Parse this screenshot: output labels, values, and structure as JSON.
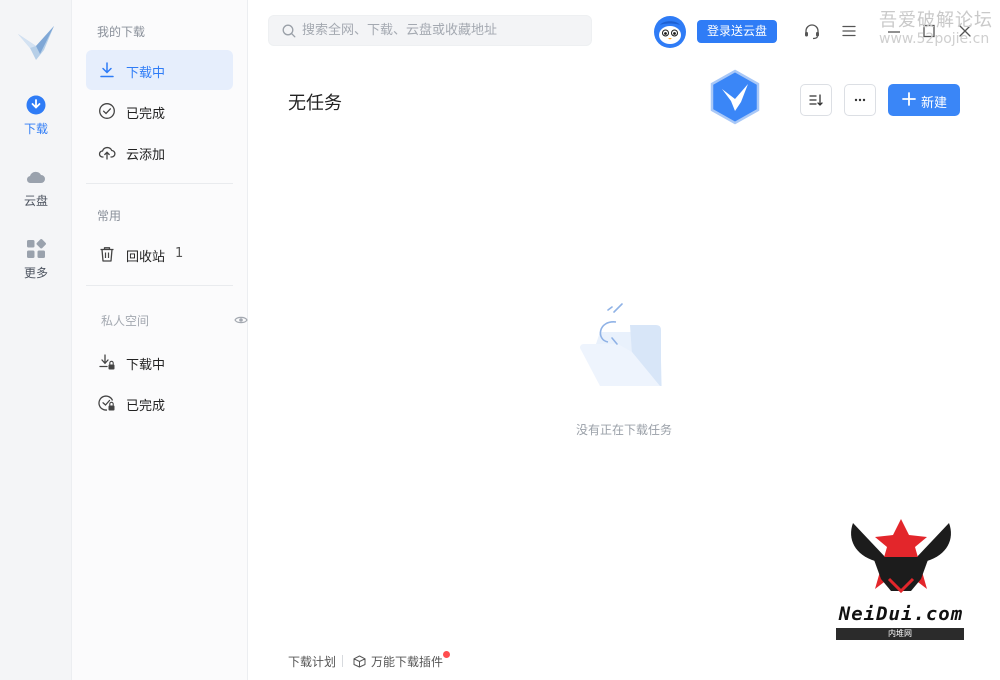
{
  "rail": {
    "items": [
      {
        "label": "下载",
        "icon": "download-circle-icon",
        "active": true
      },
      {
        "label": "云盘",
        "icon": "cloud-icon",
        "active": false
      },
      {
        "label": "更多",
        "icon": "apps-grid-icon",
        "active": false
      }
    ]
  },
  "sidebar": {
    "group_downloads": "我的下载",
    "items_downloads": [
      {
        "label": "下载中",
        "icon": "download-icon",
        "active": true
      },
      {
        "label": "已完成",
        "icon": "check-circle-icon"
      },
      {
        "label": "云添加",
        "icon": "cloud-upload-icon"
      }
    ],
    "group_common": "常用",
    "recycle": {
      "label": "回收站",
      "count": "1",
      "icon": "trash-icon"
    },
    "group_private": "私人空间",
    "items_private": [
      {
        "label": "下载中",
        "icon": "locked-download-icon"
      },
      {
        "label": "已完成",
        "icon": "locked-check-icon"
      }
    ]
  },
  "topbar": {
    "search_placeholder": "搜索全网、下载、云盘或收藏地址",
    "login_label": "登录送云盘"
  },
  "watermark": {
    "line1": "吾爱破解论坛",
    "line2": "www.52pojie.cn"
  },
  "main": {
    "title": "无任务",
    "new_label": "新建",
    "empty_text": "没有正在下载任务"
  },
  "footer": {
    "plan_label": "下载计划",
    "plugin_label": "万能下载插件"
  },
  "logo_overlay": {
    "text": "NeiDui.com",
    "subtext": "内堆网"
  },
  "colors": {
    "accent": "#2f7cf6",
    "badge_red": "#ff4d4f"
  }
}
